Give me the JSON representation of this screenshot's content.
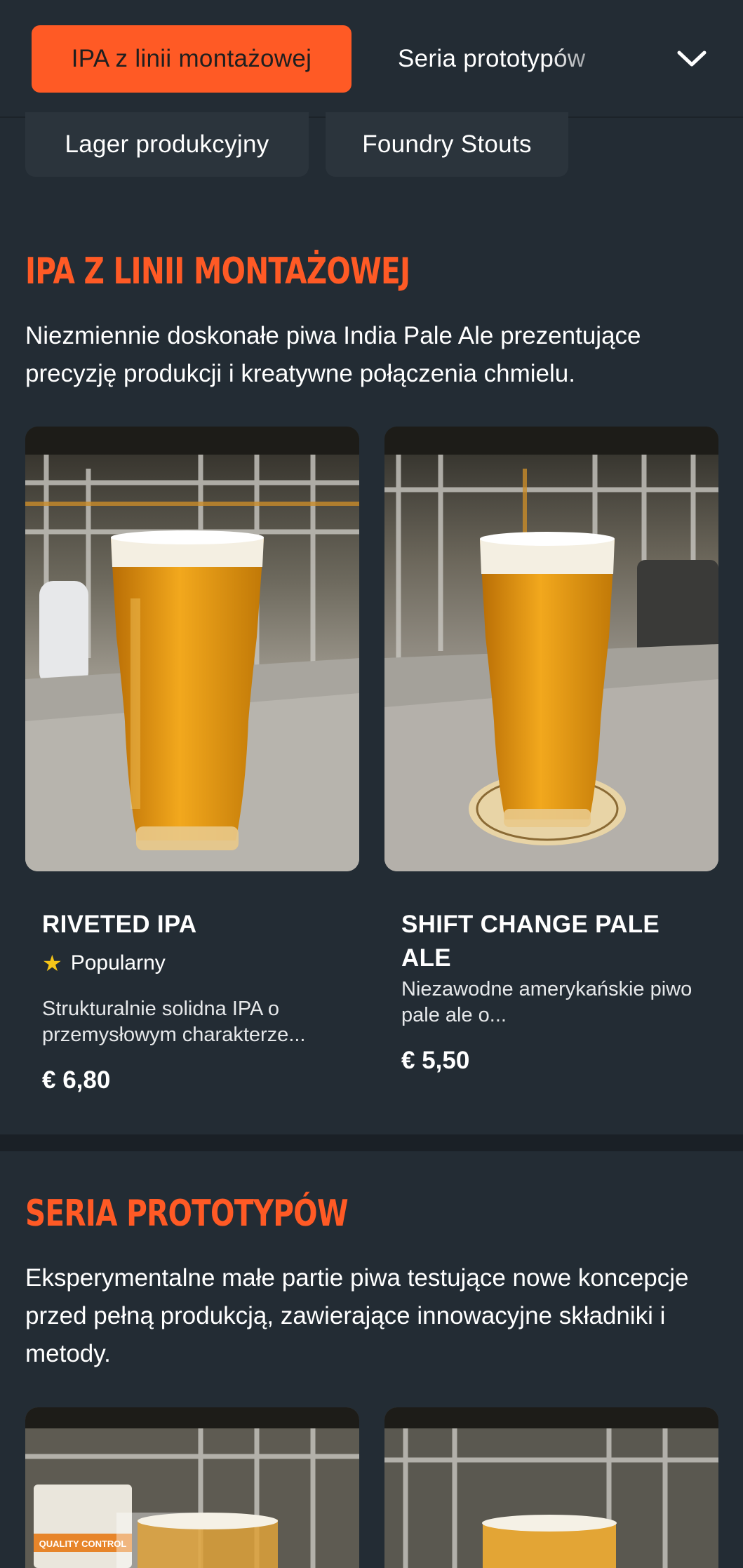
{
  "nav": {
    "categories": [
      {
        "label": "IPA z linii montażowej",
        "active": true
      },
      {
        "label": "Seria prototypów",
        "active": false
      },
      {
        "label": "Lager produkcyjny",
        "active": false
      },
      {
        "label": "Foundry Stouts",
        "active": false
      }
    ],
    "expand_icon": "chevron-down-icon"
  },
  "sections": [
    {
      "title": "IPA Z LINII MONTAŻOWEJ",
      "description": "Niezmiennie doskonałe piwa India Pale Ale prezentujące precyzję produkcji i kreatywne połączenia chmielu.",
      "products": [
        {
          "name": "RIVETED IPA",
          "badge": "Popularny",
          "badge_icon": "star-icon",
          "description": "Strukturalnie solidna IPA o przemysłowym charakterze...",
          "price": "€ 6,80"
        },
        {
          "name": "SHIFT CHANGE PALE ALE",
          "description": "Niezawodne amerykańskie piwo pale ale o...",
          "price": "€ 5,50"
        }
      ]
    },
    {
      "title": "SERIA PROTOTYPÓW",
      "description": "Eksperymentalne małe partie piwa testujące nowe koncepcje przed pełną produkcją, zawierające innowacyjne składniki i metody.",
      "products": [
        {
          "image_label": "QUALITY CONTROL"
        },
        {}
      ]
    }
  ],
  "colors": {
    "accent": "#ff5a25",
    "background": "#232c34",
    "star": "#f5c518"
  }
}
